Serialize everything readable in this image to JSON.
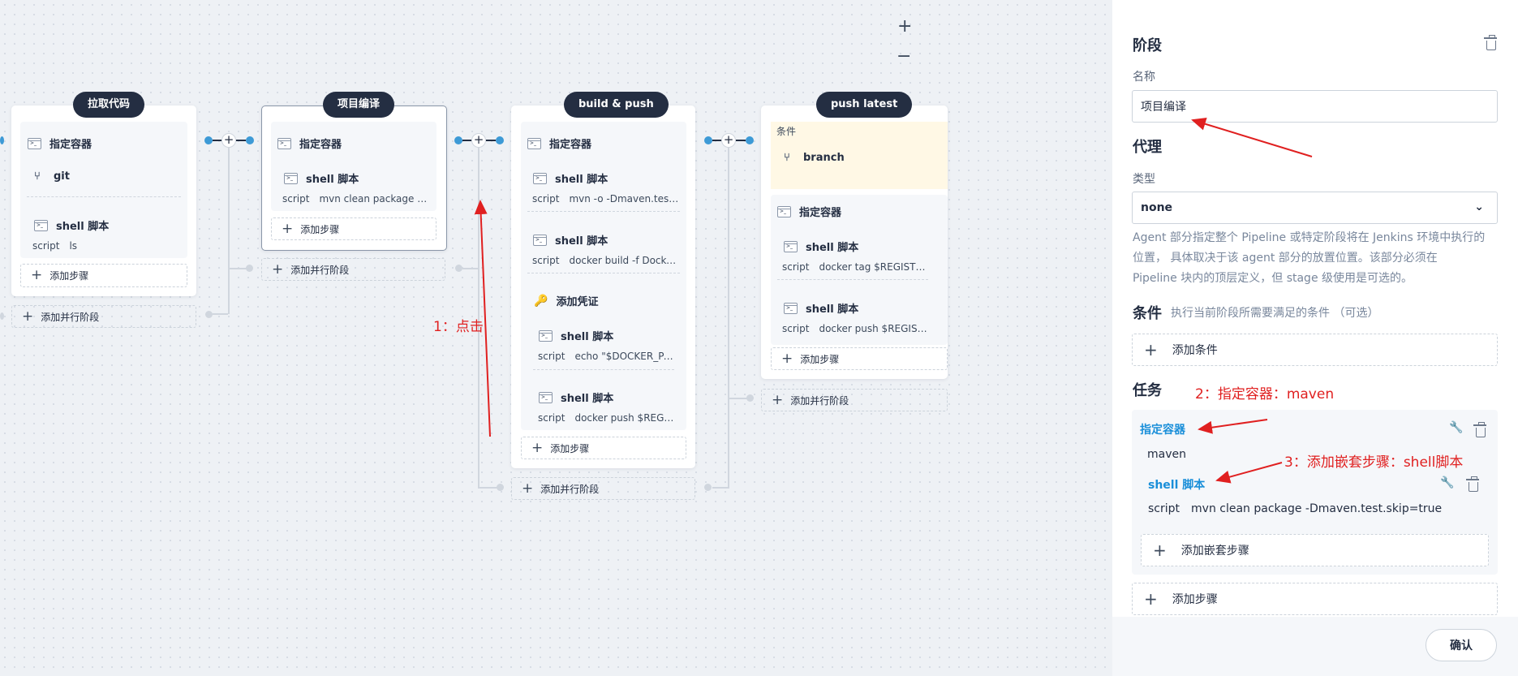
{
  "zoom": {
    "in": "+",
    "out": "−"
  },
  "stages": [
    {
      "title": "拉取代码",
      "container_step": "指定容器",
      "git_step": "git",
      "shell_label": "shell 脚本",
      "script_key": "script",
      "script_value": "ls",
      "add_step": "添加步骤",
      "add_parallel": "添加并行阶段"
    },
    {
      "title": "项目编译",
      "container_step": "指定容器",
      "shell_label": "shell 脚本",
      "script_key": "script",
      "script_value": "mvn clean package -Dmav...",
      "add_step": "添加步骤",
      "add_parallel": "添加并行阶段"
    },
    {
      "title": "build & push",
      "container_step": "指定容器",
      "steps": [
        {
          "label": "shell 脚本",
          "key": "script",
          "value": "mvn -o -Dmaven.test.skip=t..."
        },
        {
          "label": "shell 脚本",
          "key": "script",
          "value": "docker build -f Dockerfile-o..."
        }
      ],
      "credential_step": "添加凭证",
      "nested_steps": [
        {
          "label": "shell 脚本",
          "key": "script",
          "value": "echo \"$DOCKER_PASS..."
        },
        {
          "label": "shell 脚本",
          "key": "script",
          "value": "docker push $REGISTR..."
        }
      ],
      "add_step": "添加步骤",
      "add_parallel": "添加并行阶段"
    },
    {
      "title": "push latest",
      "condition_label": "条件",
      "condition_step": "branch",
      "container_step": "指定容器",
      "steps": [
        {
          "label": "shell 脚本",
          "key": "script",
          "value": "docker tag $REGISTRY/$D..."
        },
        {
          "label": "shell 脚本",
          "key": "script",
          "value": "docker push $REGISTRY/$..."
        }
      ],
      "add_step": "添加步骤",
      "add_parallel": "添加并行阶段"
    }
  ],
  "annotations": {
    "click": "1：点击",
    "container": "2：指定容器：maven",
    "nested": "3：添加嵌套步骤：shell脚本"
  },
  "panel": {
    "title": "阶段",
    "name_label": "名称",
    "name_value": "项目编译",
    "agent_title": "代理",
    "type_label": "类型",
    "type_value": "none",
    "agent_desc_lines": [
      "Agent 部分指定整个 Pipeline 或特定阶段将在 Jenkins 环境中执行的",
      "位置， 具体取决于该 agent 部分的放置位置。该部分必须在",
      "Pipeline 块内的顶层定义，但 stage 级使用是可选的。"
    ],
    "condition_title": "条件",
    "condition_desc": "执行当前阶段所需要满足的条件 （可选）",
    "add_condition": "添加条件",
    "task_title": "任务",
    "task_container_label": "指定容器",
    "task_container_value": "maven",
    "task_shell_label": "shell 脚本",
    "task_script_key": "script",
    "task_script_value": "mvn clean package -Dmaven.test.skip=true",
    "add_nested_step": "添加嵌套步骤",
    "add_step": "添加步骤",
    "confirm": "确认"
  },
  "colors": {
    "accent": "#1a8fd9",
    "dark": "#242e42",
    "annotation": "#e02020",
    "node": "#3d9ad6"
  }
}
